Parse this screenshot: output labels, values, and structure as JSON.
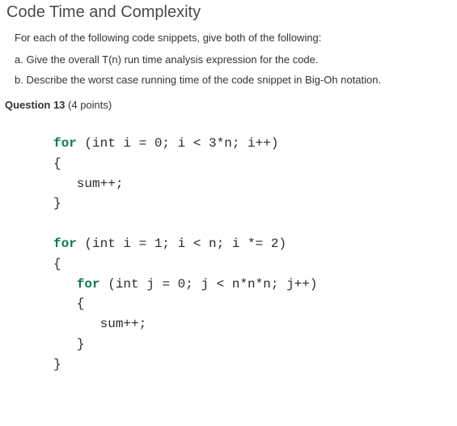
{
  "title": "Code Time and Complexity",
  "intro": "For each of the following code snippets, give both of the following:",
  "point_a": "a. Give the overall T(n) run time analysis expression for the code.",
  "point_b": "b. Describe the worst case running time of the code snippet in Big-Oh notation.",
  "question": {
    "label": "Question 13",
    "points": " (4 points)"
  },
  "code": {
    "l1_kw": "for",
    "l1_rest": " (int i = 0; i < 3*n; i++)",
    "l2": "{",
    "l3": "   sum++;",
    "l4": "}",
    "blank1": " ",
    "l5_kw": "for",
    "l5_rest": " (int i = 1; i < n; i *= 2)",
    "l6": "{",
    "l7_pad": "   ",
    "l7_kw": "for",
    "l7_rest": " (int j = 0; j < n*n*n; j++)",
    "l8": "   {",
    "l9": "      sum++;",
    "l10": "   }",
    "l11": "}"
  }
}
